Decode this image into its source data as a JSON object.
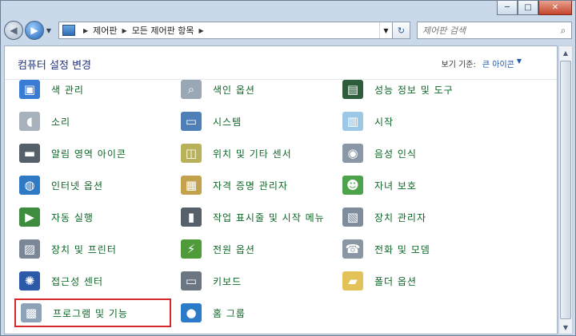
{
  "titlebar": {
    "minimize_glyph": "─",
    "maximize_glyph": "□",
    "close_glyph": "✕"
  },
  "navbar": {
    "breadcrumb": [
      "제어판",
      "모든 제어판 항목"
    ],
    "search_placeholder": "제어판 검색"
  },
  "header": {
    "title": "컴퓨터 설정 변경",
    "view_by_label": "보기 기준:",
    "view_by_value": "큰 아이콘"
  },
  "items": [
    {
      "label": "색 관리",
      "icon": "color-management-icon",
      "color": "#3a7bd5"
    },
    {
      "label": "색인 옵션",
      "icon": "indexing-options-icon",
      "color": "#9aa7b4"
    },
    {
      "label": "성능 정보 및 도구",
      "icon": "performance-icon",
      "color": "#2e5d3b"
    },
    {
      "label": "소리",
      "icon": "sound-icon",
      "color": "#a8b2bd"
    },
    {
      "label": "시스템",
      "icon": "system-icon",
      "color": "#4f7fb8"
    },
    {
      "label": "시작",
      "icon": "getting-started-icon",
      "color": "#9cc7e6"
    },
    {
      "label": "알림 영역 아이콘",
      "icon": "notification-area-icon",
      "color": "#56606b"
    },
    {
      "label": "위치 및 기타 센서",
      "icon": "location-sensors-icon",
      "color": "#b9b25a"
    },
    {
      "label": "음성 인식",
      "icon": "speech-recognition-icon",
      "color": "#8a97a6"
    },
    {
      "label": "인터넷 옵션",
      "icon": "internet-options-icon",
      "color": "#2f7ac4"
    },
    {
      "label": "자격 증명 관리자",
      "icon": "credential-manager-icon",
      "color": "#c4a14d"
    },
    {
      "label": "자녀 보호",
      "icon": "parental-controls-icon",
      "color": "#4ca34a"
    },
    {
      "label": "자동 실행",
      "icon": "autoplay-icon",
      "color": "#3e8d3e"
    },
    {
      "label": "작업 표시줄 및 시작 메뉴",
      "icon": "taskbar-start-menu-icon",
      "color": "#56606b"
    },
    {
      "label": "장치 관리자",
      "icon": "device-manager-icon",
      "color": "#7e8c9c"
    },
    {
      "label": "장치 및 프린터",
      "icon": "devices-printers-icon",
      "color": "#7a8796"
    },
    {
      "label": "전원 옵션",
      "icon": "power-options-icon",
      "color": "#4f9b3a"
    },
    {
      "label": "전화 및 모뎀",
      "icon": "phone-modem-icon",
      "color": "#8a96a3"
    },
    {
      "label": "접근성 센터",
      "icon": "ease-of-access-icon",
      "color": "#2b5aa8"
    },
    {
      "label": "키보드",
      "icon": "keyboard-icon",
      "color": "#6c7682"
    },
    {
      "label": "폴더 옵션",
      "icon": "folder-options-icon",
      "color": "#e3c25a"
    },
    {
      "label": "프로그램 및 기능",
      "icon": "programs-features-icon",
      "color": "#8fa3b8"
    },
    {
      "label": "홈 그룹",
      "icon": "homegroup-icon",
      "color": "#2c7bc8"
    }
  ],
  "highlighted_item": "프로그램 및 기능"
}
